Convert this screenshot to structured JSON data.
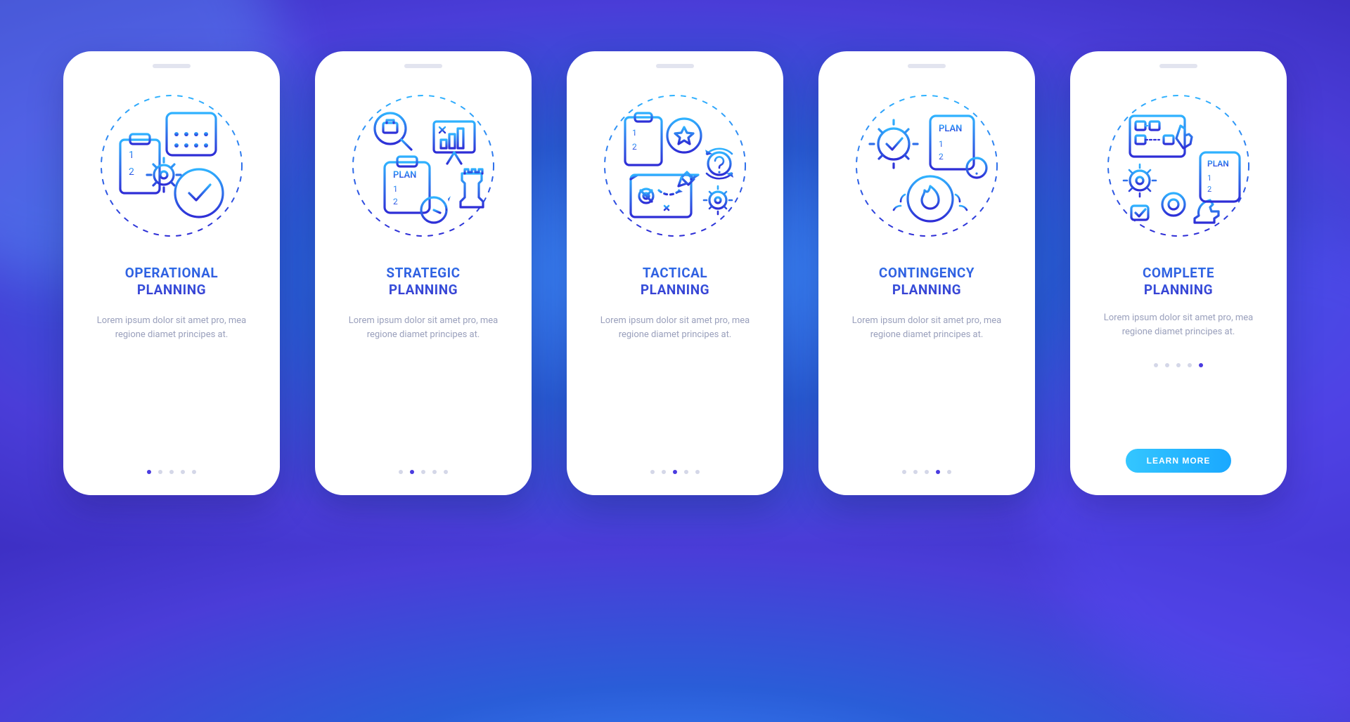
{
  "cta_label": "LEARN MORE",
  "cards": [
    {
      "id": "operational",
      "title_l1": "OPERATIONAL",
      "title_l2": "PLANNING",
      "desc": "Lorem ipsum dolor sit amet pro, mea regione diamet principes at.",
      "active_dot_index": 0,
      "has_cta": false
    },
    {
      "id": "strategic",
      "title_l1": "STRATEGIC",
      "title_l2": "PLANNING",
      "desc": "Lorem ipsum dolor sit amet pro, mea regione diamet principes at.",
      "active_dot_index": 1,
      "has_cta": false
    },
    {
      "id": "tactical",
      "title_l1": "TACTICAL",
      "title_l2": "PLANNING",
      "desc": "Lorem ipsum dolor sit amet pro, mea regione diamet principes at.",
      "active_dot_index": 2,
      "has_cta": false
    },
    {
      "id": "contingency",
      "title_l1": "CONTINGENCY",
      "title_l2": "PLANNING",
      "desc": "Lorem ipsum dolor sit amet pro, mea regione diamet principes at.",
      "active_dot_index": 3,
      "has_cta": false
    },
    {
      "id": "complete",
      "title_l1": "COMPLETE",
      "title_l2": "PLANNING",
      "desc": "Lorem ipsum dolor sit amet pro, mea regione diamet principes at.",
      "active_dot_index": 4,
      "has_cta": true
    }
  ],
  "dot_count": 5
}
